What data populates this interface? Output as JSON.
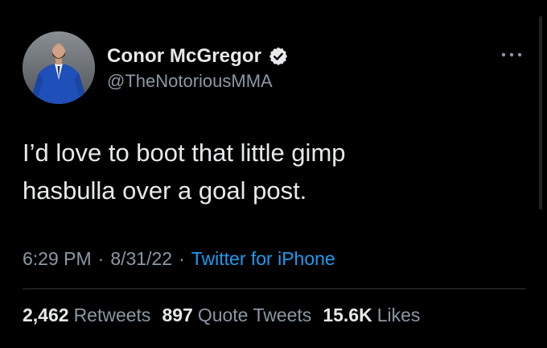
{
  "user": {
    "display_name": "Conor McGregor",
    "handle": "@TheNotoriousMMA",
    "avatar_icon": "profile-photo",
    "verified_icon": "verified-badge-icon"
  },
  "tweet": {
    "text": "I’d love to boot that little gimp\nhasbulla over a goal post.",
    "time": "6:29 PM",
    "date": "8/31/22",
    "source": "Twitter for iPhone",
    "separator": "·"
  },
  "stats": {
    "retweets_count": "2,462",
    "retweets_label": "Retweets",
    "quote_count": "897",
    "quote_label": "Quote Tweets",
    "likes_count": "15.6K",
    "likes_label": "Likes"
  },
  "colors": {
    "background": "#000000",
    "text_primary": "#e7e9ea",
    "text_secondary": "#8b98a5",
    "link": "#1d9bf0",
    "divider": "#2f3336"
  }
}
